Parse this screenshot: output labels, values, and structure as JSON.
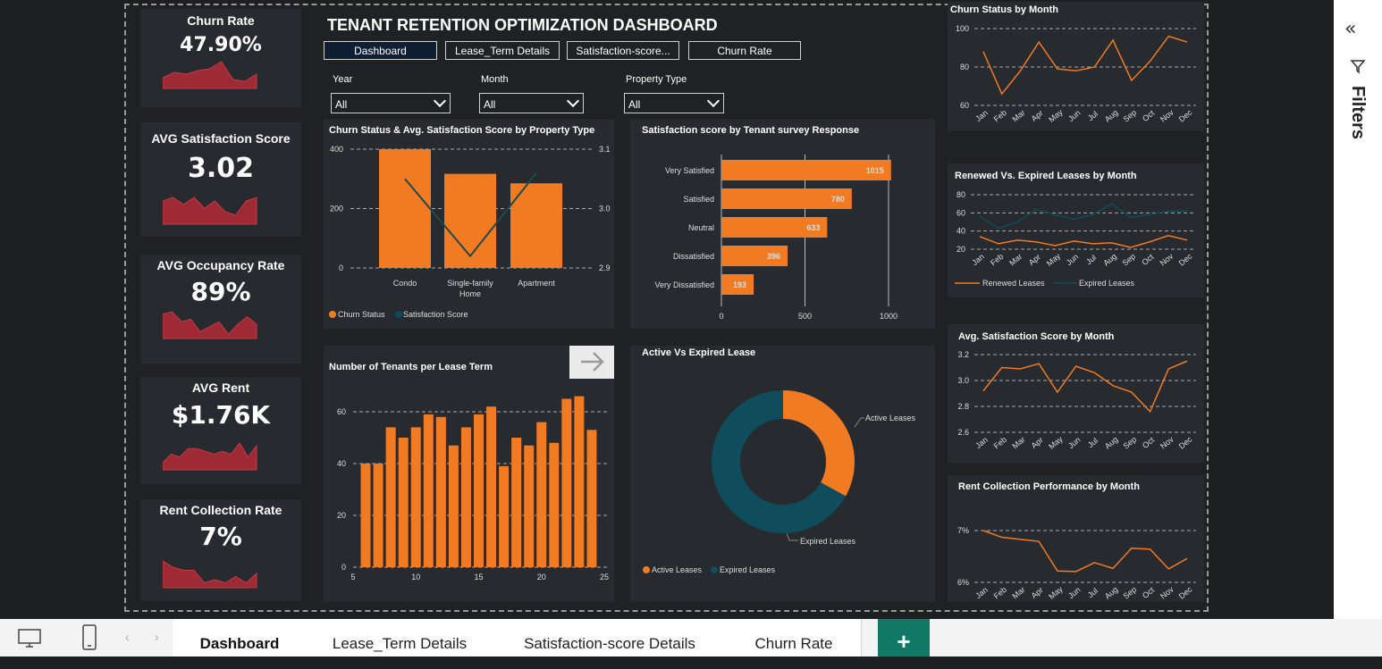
{
  "dashboard_title": "TENANT RETENTION OPTIMIZATION DASHBOARD",
  "nav_buttons": [
    "Dashboard",
    "Lease_Term Details",
    "Satisfaction-score...",
    "Churn Rate"
  ],
  "slicers": [
    {
      "label": "Year",
      "value": "All"
    },
    {
      "label": "Month",
      "value": "All"
    },
    {
      "label": "Property Type",
      "value": "All"
    }
  ],
  "kpis": [
    {
      "title": "Churn Rate",
      "value": "47.90%"
    },
    {
      "title": "AVG Satisfaction Score",
      "value": "3.02"
    },
    {
      "title": "AVG Occupancy Rate",
      "value": "89%"
    },
    {
      "title": "AVG Rent",
      "value": "$1.76K"
    },
    {
      "title": "Rent Collection Rate",
      "value": "7%"
    }
  ],
  "colors": {
    "orange": "#f07b23",
    "teal": "#0f4c5c",
    "sparkline": "#9e2a35"
  },
  "right_pane": {
    "label": "Filters"
  },
  "bottom_tabs": [
    "Dashboard",
    "Lease_Term Details",
    "Satisfaction-score Details",
    "Churn Rate"
  ],
  "add_tab_label": "+",
  "chart_data": [
    {
      "id": "churn_by_property",
      "type": "bar",
      "title": "Churn Status & Avg. Satisfaction Score by Property Type",
      "categories": [
        "Condo",
        "Single-family Home",
        "Apartment"
      ],
      "series": [
        {
          "name": "Churn Status",
          "type": "bar",
          "values": [
            400,
            317,
            285
          ]
        },
        {
          "name": "Satisfaction Score",
          "type": "line",
          "axis": "secondary",
          "values": [
            3.05,
            2.92,
            3.06
          ]
        }
      ],
      "ylim": [
        0,
        400
      ],
      "yticks": [
        0,
        200,
        400
      ],
      "y2lim": [
        2.9,
        3.1
      ],
      "y2ticks": [
        2.9,
        3.0,
        3.1
      ],
      "legend": "bottom-left"
    },
    {
      "id": "satisfaction_by_response",
      "type": "bar",
      "orientation": "horizontal",
      "title": "Satisfaction score by Tenant survey Response",
      "categories": [
        "Very Satisfied",
        "Satisfied",
        "Neutral",
        "Dissatisfied",
        "Very Dissatisfied"
      ],
      "values": [
        1015,
        780,
        633,
        396,
        193
      ],
      "xlim": [
        0,
        1000
      ],
      "xticks": [
        0,
        500,
        1000
      ]
    },
    {
      "id": "tenants_per_lease_term",
      "type": "bar",
      "title": "Number of Tenants per Lease Term",
      "categories": [
        6,
        7,
        8,
        9,
        10,
        11,
        12,
        13,
        14,
        15,
        16,
        17,
        18,
        19,
        20,
        21,
        22,
        23,
        24
      ],
      "values": [
        40,
        40,
        54,
        50,
        54,
        59,
        58,
        47,
        54,
        59,
        62,
        39,
        50,
        47,
        56,
        48,
        65,
        66,
        53
      ],
      "ylim": [
        0,
        60
      ],
      "yticks": [
        0,
        20,
        40,
        60
      ],
      "xticks": [
        5,
        10,
        15,
        20,
        25
      ]
    },
    {
      "id": "active_vs_expired",
      "type": "pie",
      "title": "Active Vs Expired Lease",
      "categories": [
        "Active Leases",
        "Expired Leases"
      ],
      "values": [
        33,
        67
      ],
      "legend": "bottom-left"
    },
    {
      "id": "churn_by_month",
      "type": "line",
      "title": "Churn Status by Month",
      "categories": [
        "Jan",
        "Feb",
        "Mar",
        "Apr",
        "May",
        "Jun",
        "Jul",
        "Aug",
        "Sep",
        "Oct",
        "Nov",
        "Dec"
      ],
      "series": [
        {
          "values": [
            88,
            66,
            78,
            93,
            79,
            78,
            80,
            94,
            73,
            83,
            96,
            93
          ]
        }
      ],
      "ylim": [
        60,
        100
      ],
      "yticks": [
        60,
        80,
        100
      ]
    },
    {
      "id": "renewed_vs_expired",
      "type": "line",
      "title": "Renewed Vs. Expired Leases by Month",
      "categories": [
        "Jan",
        "Feb",
        "Mar",
        "Apr",
        "May",
        "Jun",
        "Jul",
        "Aug",
        "Sep",
        "Oct",
        "Nov",
        "Dec"
      ],
      "series": [
        {
          "name": "Renewed Leases",
          "values": [
            34,
            26,
            30,
            28,
            24,
            29,
            26,
            27,
            22,
            28,
            35,
            30
          ]
        },
        {
          "name": "Expired Leases",
          "values": [
            56,
            43,
            50,
            64,
            58,
            53,
            58,
            70,
            55,
            58,
            62,
            62
          ]
        }
      ],
      "ylim": [
        20,
        80
      ],
      "yticks": [
        20,
        40,
        60,
        80
      ],
      "legend": "bottom"
    },
    {
      "id": "satisfaction_by_month",
      "type": "line",
      "title": "Avg. Satisfaction Score by Month",
      "categories": [
        "Jan",
        "Feb",
        "Mar",
        "Apr",
        "May",
        "Jun",
        "Jul",
        "Aug",
        "Sep",
        "Oct",
        "Nov",
        "Dec"
      ],
      "series": [
        {
          "values": [
            2.92,
            3.1,
            3.09,
            3.13,
            2.91,
            3.11,
            3.06,
            2.96,
            2.91,
            2.76,
            3.09,
            3.15
          ]
        }
      ],
      "ylim": [
        2.6,
        3.2
      ],
      "yticks": [
        2.6,
        2.8,
        3.0,
        3.2
      ]
    },
    {
      "id": "rent_collection_by_month",
      "type": "line",
      "title": "Rent Collection Performance by Month",
      "categories": [
        "Jan",
        "Feb",
        "Mar",
        "Apr",
        "May",
        "Jun",
        "Jul",
        "Aug",
        "Sep",
        "Oct",
        "Nov",
        "Dec"
      ],
      "series": [
        {
          "values": [
            7.0,
            6.87,
            6.83,
            6.79,
            6.22,
            6.21,
            6.38,
            6.27,
            6.66,
            6.64,
            6.26,
            6.46
          ]
        }
      ],
      "ylim": [
        6,
        7
      ],
      "yticks": [
        6,
        7
      ],
      "tick_suffix": "%"
    }
  ],
  "sparklines": [
    [
      5,
      8,
      7,
      9,
      10,
      14,
      4,
      3,
      7
    ],
    [
      6,
      7,
      5,
      7,
      4,
      6,
      3,
      2,
      6,
      7
    ],
    [
      9,
      10,
      6,
      7,
      2,
      4,
      6,
      1,
      5,
      8,
      5
    ],
    [
      2,
      5,
      4,
      7,
      7,
      6,
      5,
      6,
      5,
      9,
      4,
      8
    ],
    [
      8,
      6,
      5,
      5,
      1,
      2,
      1,
      3,
      1,
      4
    ]
  ]
}
